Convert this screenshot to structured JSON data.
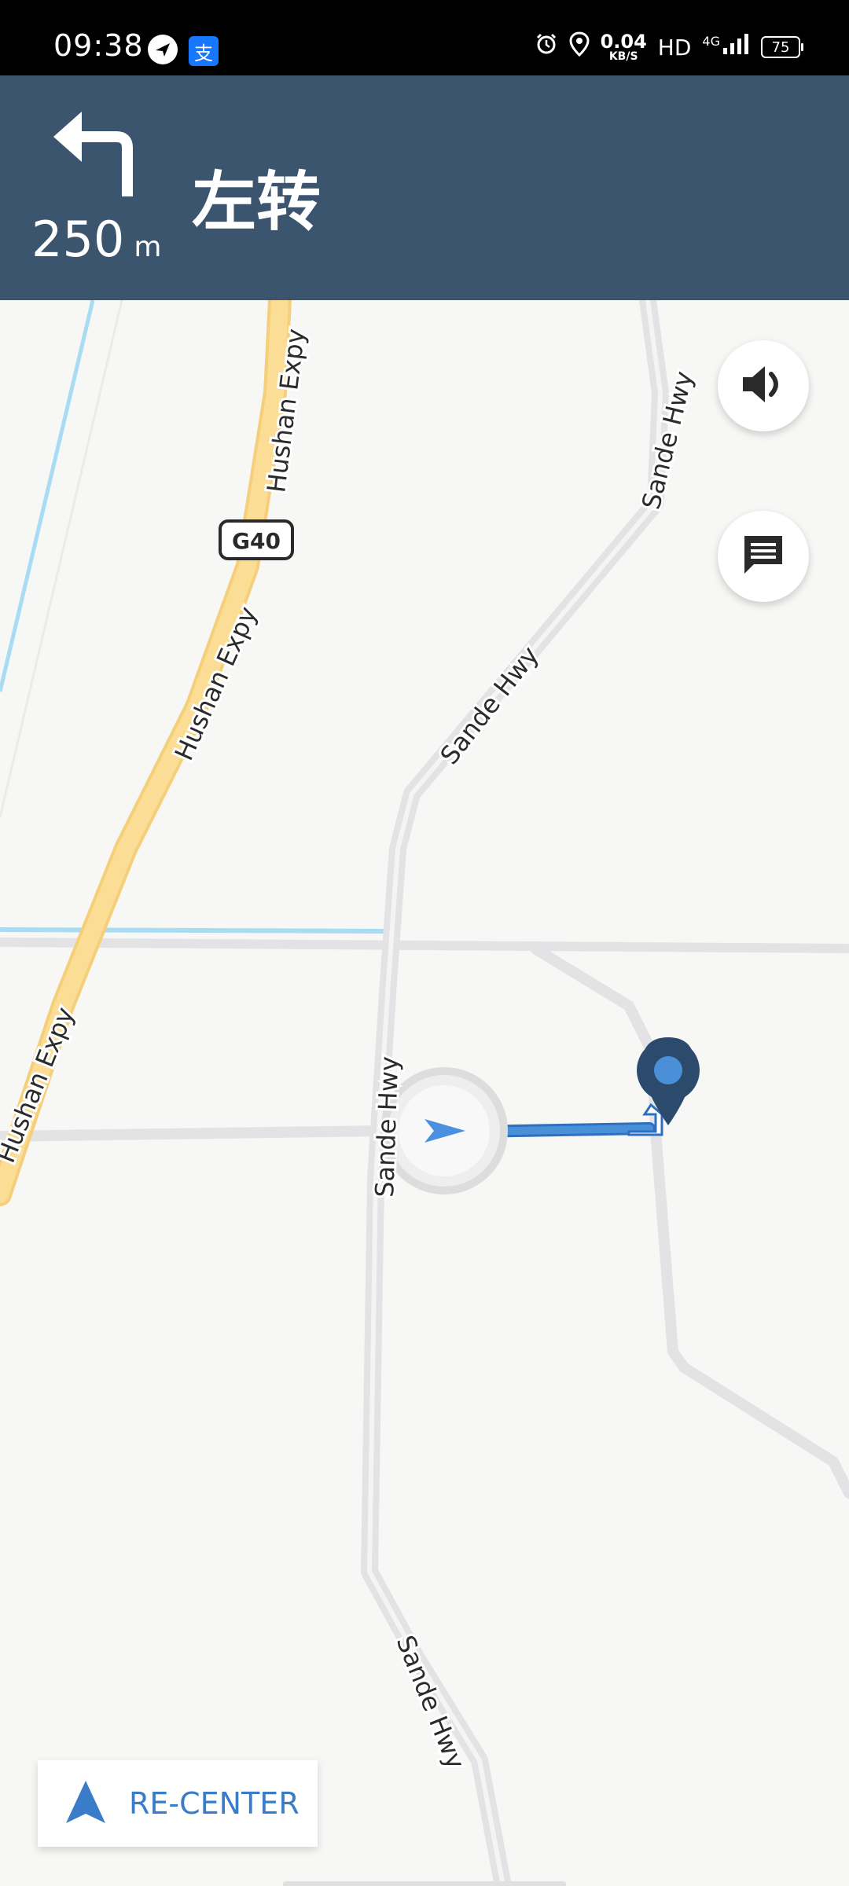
{
  "status_bar": {
    "time": "09:38",
    "alipay_label": "支",
    "net_speed_value": "0.04",
    "net_speed_unit": "KB/S",
    "hd_label": "HD",
    "network_label": "4G",
    "battery_level": "75"
  },
  "navigation": {
    "maneuver_icon": "turn-left-icon",
    "distance_value": "250",
    "distance_unit": "m",
    "instruction": "左转"
  },
  "map": {
    "road_labels": {
      "hushan_1": "Hushan Expy",
      "hushan_2": "Hushan Expy",
      "hushan_3": "Hushan Expy",
      "sande_1": "Sande Hwy",
      "sande_2": "Sande Hwy",
      "sande_3": "Sande Hwy",
      "sande_4": "Sande Hwy"
    },
    "highway_shield": "G40",
    "colors": {
      "expressway": "#fbd98a",
      "route": "#4a90d9",
      "destination": "#3f86d8",
      "water": "#a8dcf2",
      "road": "#e3e3e6"
    }
  },
  "controls": {
    "sound_icon": "volume-icon",
    "report_icon": "message-icon",
    "recenter_label": "RE-CENTER"
  }
}
